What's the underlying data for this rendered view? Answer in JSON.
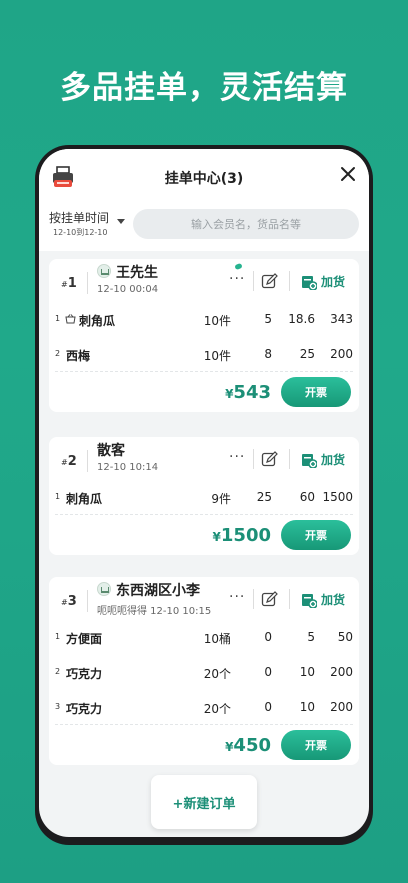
{
  "promo": {
    "title": "多品挂单，灵活结算"
  },
  "header": {
    "title": "挂单中心(3)"
  },
  "filter": {
    "sort_label": "按挂单时间",
    "date_range": "12-10到12-10",
    "search_placeholder": "输入会员名，货品名等"
  },
  "actions": {
    "more": "···",
    "add_goods": "加货",
    "invoice": "开票",
    "currency": "¥",
    "new_order": "+新建订单"
  },
  "orders": [
    {
      "no": "1",
      "customer": "王先生",
      "time": "12-10 00:04",
      "items": [
        {
          "idx": "1",
          "name": "刺角瓜",
          "qty": "10件",
          "a": "5",
          "b": "18.6",
          "c": "343"
        },
        {
          "idx": "2",
          "name": "西梅",
          "qty": "10件",
          "a": "8",
          "b": "25",
          "c": "200"
        }
      ],
      "total": "543"
    },
    {
      "no": "2",
      "customer": "散客",
      "time": "12-10 10:14",
      "items": [
        {
          "idx": "1",
          "name": "刺角瓜",
          "qty": "9件",
          "a": "25",
          "b": "60",
          "c": "1500"
        }
      ],
      "total": "1500"
    },
    {
      "no": "3",
      "customer": "东西湖区小李",
      "time": "呃呃呃得得 12-10 10:15",
      "items": [
        {
          "idx": "1",
          "name": "方便面",
          "qty": "10桶",
          "a": "0",
          "b": "5",
          "c": "50"
        },
        {
          "idx": "2",
          "name": "巧克力",
          "qty": "20个",
          "a": "0",
          "b": "10",
          "c": "200"
        },
        {
          "idx": "3",
          "name": "巧克力",
          "qty": "20个",
          "a": "0",
          "b": "10",
          "c": "200"
        }
      ],
      "total": "450"
    }
  ]
}
